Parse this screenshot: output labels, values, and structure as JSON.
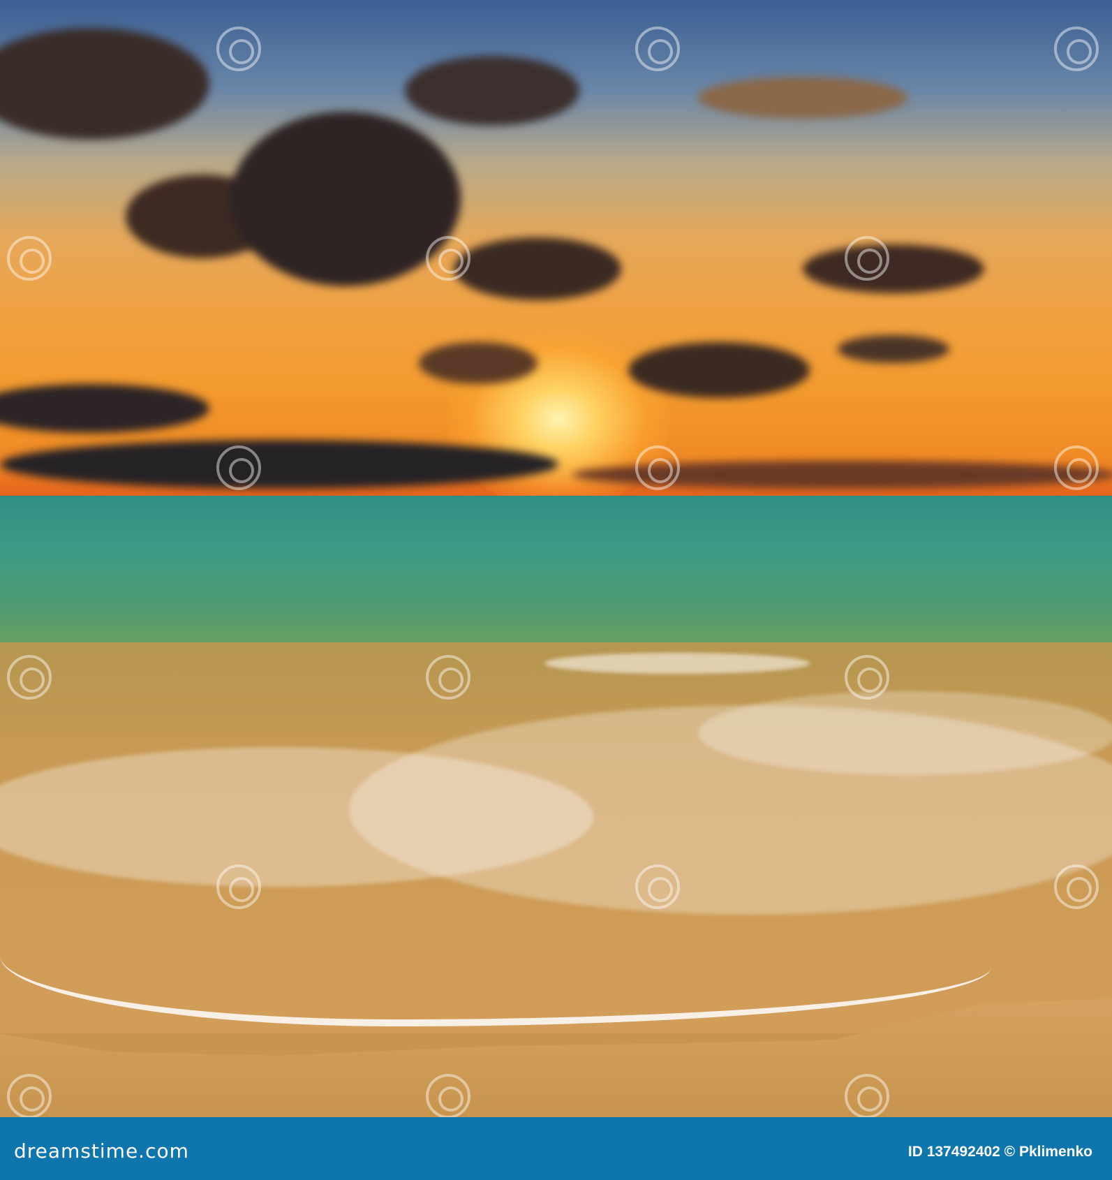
{
  "image": {
    "subject": "sunset-over-sea-beach"
  },
  "watermark": {
    "brand": "dreamstime"
  },
  "footer": {
    "logo_text": "dreamstime.com",
    "credit": "ID 137492402 © Pklimenko",
    "bar_color": "#0f76ad"
  }
}
